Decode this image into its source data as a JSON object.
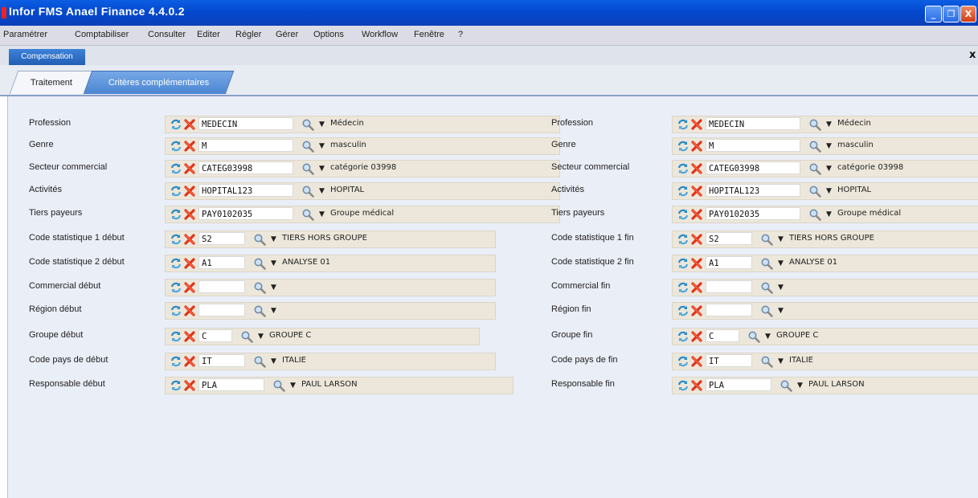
{
  "app": {
    "title": "Infor FMS Anael Finance 4.4.0.2",
    "window_buttons": [
      "_",
      "❐",
      "X"
    ]
  },
  "menu": [
    "Paramétrer",
    "Comptabiliser",
    "Consulter",
    "Editer",
    "Régler",
    "Gérer",
    "Options",
    "Workflow",
    "Fenêtre",
    "?"
  ],
  "document_tab": {
    "label": "Compensation",
    "close": "x"
  },
  "subtabs": [
    {
      "label": "Traitement"
    },
    {
      "label": "Critères complémentaires"
    }
  ],
  "colors": {
    "title_bar": "#0349cf",
    "active_tab": "#4c86d2",
    "field_bg": "#ece7da",
    "content_bg": "#eaeef7"
  },
  "left_rows": [
    {
      "label": "Profession",
      "code": "MEDECIN",
      "desc": "Médecin"
    },
    {
      "label": "Genre",
      "code": "M",
      "desc": "masculin"
    },
    {
      "label": "Secteur commercial",
      "code": "CATEG03998",
      "desc": "catégorie 03998"
    },
    {
      "label": "Activités",
      "code": "HOPITAL123",
      "desc": "HOPITAL"
    },
    {
      "label": "Tiers payeurs",
      "code": "PAY0102035",
      "desc": "Groupe médical"
    },
    {
      "label": "Code statistique 1 début",
      "code": "S2",
      "desc": "TIERS HORS GROUPE"
    },
    {
      "label": "Code statistique 2 début",
      "code": "A1",
      "desc": "ANALYSE 01"
    },
    {
      "label": "Commercial début",
      "code": "",
      "desc": ""
    },
    {
      "label": "Région début",
      "code": "",
      "desc": ""
    },
    {
      "label": "Groupe début",
      "code": "C",
      "desc": "GROUPE C"
    },
    {
      "label": "Code pays de début",
      "code": "IT",
      "desc": "ITALIE"
    },
    {
      "label": "Responsable début",
      "code": "PLA",
      "desc": "PAUL LARSON"
    }
  ],
  "right_rows": [
    {
      "label": "Profession",
      "code": "MEDECIN",
      "desc": "Médecin"
    },
    {
      "label": "Genre",
      "code": "M",
      "desc": "masculin"
    },
    {
      "label": "Secteur commercial",
      "code": "CATEG03998",
      "desc": "catégorie 03998"
    },
    {
      "label": "Activités",
      "code": "HOPITAL123",
      "desc": "HOPITAL"
    },
    {
      "label": "Tiers payeurs",
      "code": "PAY0102035",
      "desc": "Groupe médical"
    },
    {
      "label": "Code statistique 1 fin",
      "code": "S2",
      "desc": "TIERS HORS GROUPE"
    },
    {
      "label": "Code statistique 2 fin",
      "code": "A1",
      "desc": "ANALYSE 01"
    },
    {
      "label": "Commercial fin",
      "code": "",
      "desc": ""
    },
    {
      "label": "Région fin",
      "code": "",
      "desc": ""
    },
    {
      "label": "Groupe fin",
      "code": "C",
      "desc": "GROUPE C"
    },
    {
      "label": "Code pays de fin",
      "code": "IT",
      "desc": "ITALIE"
    },
    {
      "label": "Responsable fin",
      "code": "PLA",
      "desc": "PAUL LARSON"
    }
  ]
}
